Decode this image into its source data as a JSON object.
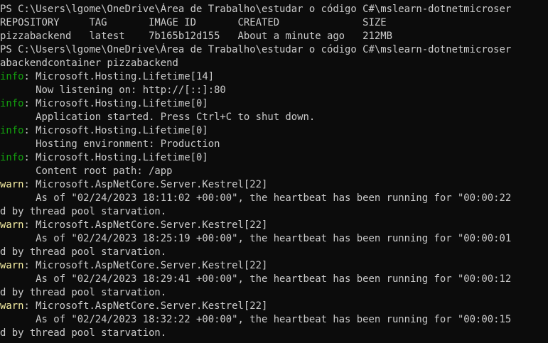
{
  "terminal": {
    "lines": [
      {
        "text": "PS C:\\Users\\lgome\\OneDrive\\Área de Trabalho\\estudar o código C#\\mslearn-dotnetmicroser"
      },
      {
        "text": "REPOSITORY     TAG       IMAGE ID       CREATED              SIZE"
      },
      {
        "text": "pizzabackend   latest    7b165b12d155   About a minute ago   212MB"
      },
      {
        "text": "PS C:\\Users\\lgome\\OneDrive\\Área de Trabalho\\estudar o código C#\\mslearn-dotnetmicroser"
      },
      {
        "text": "abackendcontainer pizzabackend"
      },
      {
        "level": "info",
        "text": ": Microsoft.Hosting.Lifetime[14]"
      },
      {
        "text": "      Now listening on: http://[::]:80"
      },
      {
        "level": "info",
        "text": ": Microsoft.Hosting.Lifetime[0]"
      },
      {
        "text": "      Application started. Press Ctrl+C to shut down."
      },
      {
        "level": "info",
        "text": ": Microsoft.Hosting.Lifetime[0]"
      },
      {
        "text": "      Hosting environment: Production"
      },
      {
        "level": "info",
        "text": ": Microsoft.Hosting.Lifetime[0]"
      },
      {
        "text": "      Content root path: /app"
      },
      {
        "level": "warn",
        "text": ": Microsoft.AspNetCore.Server.Kestrel[22]"
      },
      {
        "text": "      As of \"02/24/2023 18:11:02 +00:00\", the heartbeat has been running for \"00:00:22"
      },
      {
        "text": "d by thread pool starvation."
      },
      {
        "level": "warn",
        "text": ": Microsoft.AspNetCore.Server.Kestrel[22]"
      },
      {
        "text": "      As of \"02/24/2023 18:25:19 +00:00\", the heartbeat has been running for \"00:00:01"
      },
      {
        "text": "d by thread pool starvation."
      },
      {
        "level": "warn",
        "text": ": Microsoft.AspNetCore.Server.Kestrel[22]"
      },
      {
        "text": "      As of \"02/24/2023 18:29:41 +00:00\", the heartbeat has been running for \"00:00:12"
      },
      {
        "text": "d by thread pool starvation."
      },
      {
        "level": "warn",
        "text": ": Microsoft.AspNetCore.Server.Kestrel[22]"
      },
      {
        "text": "      As of \"02/24/2023 18:32:22 +00:00\", the heartbeat has been running for \"00:00:15"
      },
      {
        "text": "d by thread pool starvation."
      }
    ]
  },
  "colors": {
    "background": "#0c0c0c",
    "foreground": "#cccccc",
    "info": "#13a10e",
    "warn": "#f9f1a5"
  }
}
